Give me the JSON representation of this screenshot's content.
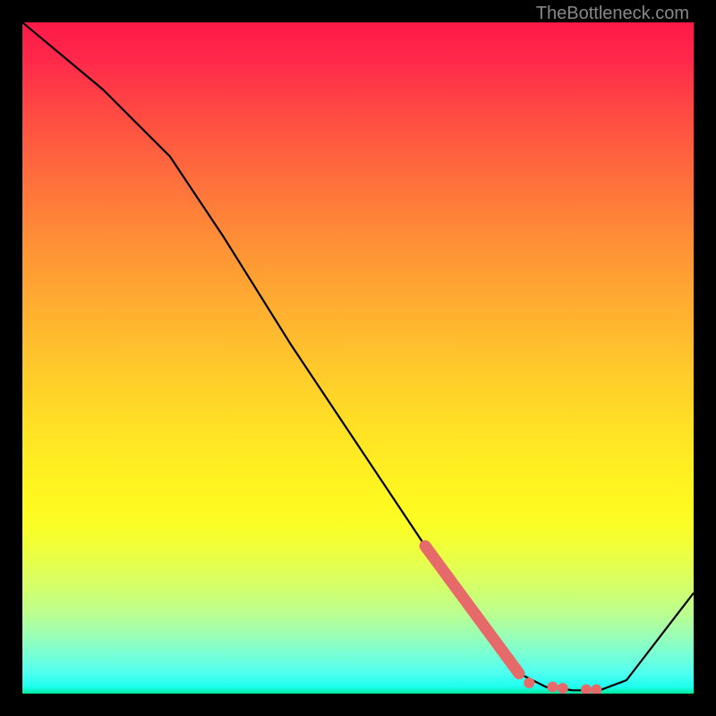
{
  "watermark": "TheBottleneck.com",
  "chart_data": {
    "type": "line",
    "title": "",
    "xlabel": "",
    "ylabel": "",
    "xlim": [
      0,
      100
    ],
    "ylim": [
      0,
      100
    ],
    "series": [
      {
        "name": "curve",
        "color": "#000000",
        "x": [
          0,
          12,
          22,
          30,
          40,
          50,
          60,
          68,
          74,
          78,
          82,
          86,
          90,
          100
        ],
        "y": [
          100,
          90,
          80,
          68,
          52,
          37,
          22,
          10,
          3,
          1,
          0.5,
          0.5,
          2,
          15
        ]
      }
    ],
    "highlight": {
      "color": "#e76a6a",
      "segment": {
        "x": [
          60,
          74
        ],
        "y": [
          22,
          3
        ]
      },
      "dots": [
        {
          "x": 75.5,
          "y": 1.6
        },
        {
          "x": 79,
          "y": 1.0
        },
        {
          "x": 80.5,
          "y": 0.8
        },
        {
          "x": 84,
          "y": 0.6
        },
        {
          "x": 85.5,
          "y": 0.6
        }
      ]
    },
    "background": "heat-gradient"
  }
}
